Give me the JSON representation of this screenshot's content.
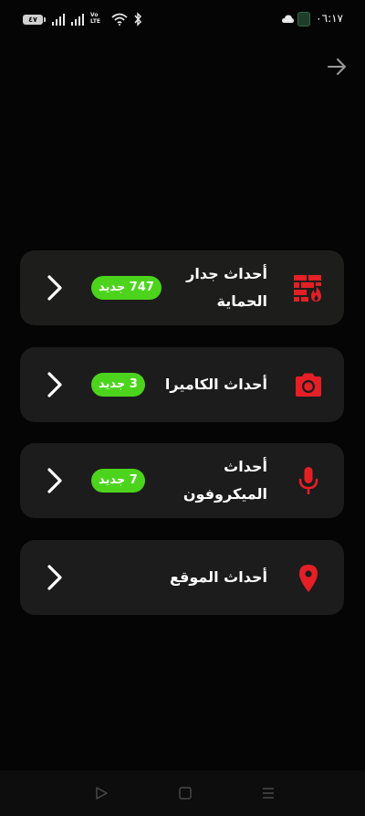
{
  "status_bar": {
    "battery": "٤٧",
    "volte_line1": "Vo",
    "volte_line2": "LTE",
    "time": "٠٦:١٧"
  },
  "header": {
    "forward_icon": "arrow-right-icon"
  },
  "cards": [
    {
      "label": "أحداث جدار الحماية",
      "badge": "747 جديد",
      "icon": "firewall-icon",
      "icon_color": "#e41f26"
    },
    {
      "label": "أحداث الكاميرا",
      "badge": "3 جديد",
      "icon": "camera-icon",
      "icon_color": "#e41f26"
    },
    {
      "label": "أحداث الميكروفون",
      "badge": "7 جديد",
      "icon": "microphone-icon",
      "icon_color": "#e41f26"
    },
    {
      "label": "أحداث الموقع",
      "badge": "",
      "icon": "location-pin-icon",
      "icon_color": "#e41f26"
    }
  ],
  "colors": {
    "background": "#050505",
    "card": "#1c1c1c",
    "badge": "#4cd41d",
    "accent": "#e41f26"
  }
}
